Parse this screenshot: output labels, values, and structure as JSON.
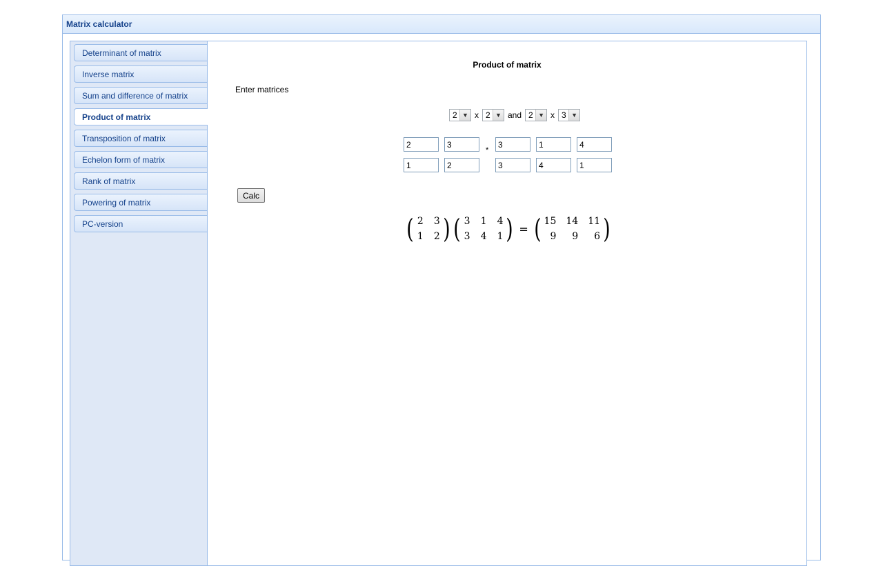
{
  "window": {
    "title": "Matrix calculator"
  },
  "sidebar": {
    "items": [
      {
        "label": "Determinant of matrix"
      },
      {
        "label": "Inverse matrix"
      },
      {
        "label": "Sum and difference of matrix"
      },
      {
        "label": "Product of matrix",
        "active": true
      },
      {
        "label": "Transposition of matrix"
      },
      {
        "label": "Echelon form of matrix"
      },
      {
        "label": "Rank of matrix"
      },
      {
        "label": "Powering of matrix"
      },
      {
        "label": "PC-version"
      }
    ]
  },
  "main": {
    "title": "Product of matrix",
    "enter_label": "Enter matrices",
    "dims": {
      "a_rows": "2",
      "a_cols": "2",
      "and_label": "and",
      "b_rows": "2",
      "b_cols": "3",
      "x_label": "x"
    },
    "times_sign": "*",
    "matrix_a": [
      [
        "2",
        "3"
      ],
      [
        "1",
        "2"
      ]
    ],
    "matrix_b": [
      [
        "3",
        "1",
        "4"
      ],
      [
        "3",
        "4",
        "1"
      ]
    ],
    "calc_label": "Calc",
    "result": {
      "a": [
        [
          "2",
          "3"
        ],
        [
          "1",
          "2"
        ]
      ],
      "b": [
        [
          "3",
          "1",
          "4"
        ],
        [
          "3",
          "4",
          "1"
        ]
      ],
      "product": [
        [
          "15",
          "14",
          "11"
        ],
        [
          "9",
          "9",
          "6"
        ]
      ],
      "equals": "="
    }
  }
}
